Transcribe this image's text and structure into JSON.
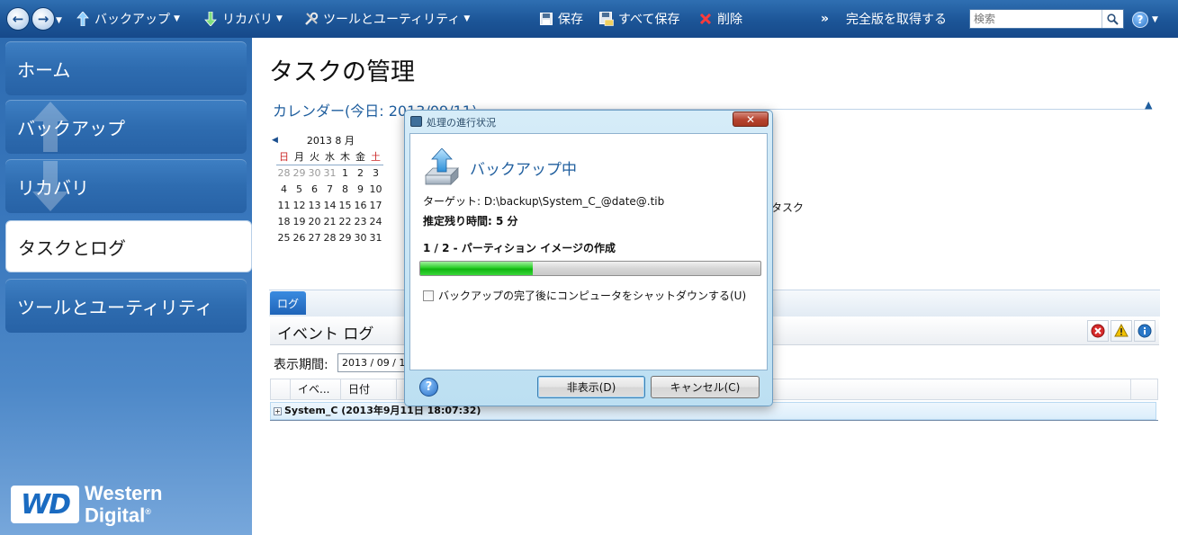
{
  "toolbar": {
    "backup_label": "バックアップ",
    "recovery_label": "リカバリ",
    "tools_label": "ツールとユーティリティ",
    "save_label": "保存",
    "save_all_label": "すべて保存",
    "delete_label": "削除",
    "more_label": "»",
    "full_version_label": "完全版を取得する",
    "search_placeholder": "検索"
  },
  "sidebar": {
    "items": [
      {
        "label": "ホーム"
      },
      {
        "label": "バックアップ"
      },
      {
        "label": "リカバリ"
      },
      {
        "label": "タスクとログ"
      },
      {
        "label": "ツールとユーティリティ"
      }
    ],
    "logo_badge": "WD",
    "logo_line1": "Western",
    "logo_line2": "Digital"
  },
  "main": {
    "title": "タスクの管理",
    "calendar_header": "カレンダー(今日: 2013/09/11)",
    "calendar_month": "2013 8 月",
    "weekdays": [
      "日",
      "月",
      "火",
      "水",
      "木",
      "金",
      "土"
    ],
    "weeks": [
      [
        "28",
        "29",
        "30",
        "31",
        "1",
        "2",
        "3"
      ],
      [
        "4",
        "5",
        "6",
        "7",
        "8",
        "9",
        "10"
      ],
      [
        "11",
        "12",
        "13",
        "14",
        "15",
        "16",
        "17"
      ],
      [
        "18",
        "19",
        "20",
        "21",
        "22",
        "23",
        "24"
      ],
      [
        "25",
        "26",
        "27",
        "28",
        "29",
        "30",
        "31"
      ]
    ],
    "task_text": "たタスク",
    "log_tab": "ログ",
    "event_log_title": "イベント ログ",
    "period_label": "表示期間:",
    "period_value": "2013 / 09 / 11",
    "columns": [
      "イベ...",
      "日付"
    ],
    "row_text": "System_C  (2013年9月11日 18:07:32)"
  },
  "dialog": {
    "title": "処理の進行状況",
    "heading": "バックアップ中",
    "target": "ターゲット: D:\\backup\\System_C_@date@.tib",
    "remaining": "推定残り時間: 5 分",
    "step": "1 / 2 - パーティション イメージの作成",
    "progress": 0.33,
    "shutdown_label": "バックアップの完了後にコンピュータをシャットダウンする(U)",
    "hide_button": "非表示(D)",
    "cancel_button": "キャンセル(C)",
    "close_glyph": "✕"
  },
  "colors": {
    "accent": "#1f5e9e",
    "toolbar": "#1c5597",
    "progress_green": "#10b510",
    "error_red": "#d62b2b",
    "warning_yellow": "#f2c200",
    "info_blue": "#2a78c8"
  },
  "icons": {
    "back": "back-arrow-icon",
    "forward": "forward-arrow-icon",
    "backup": "backup-arrow-up-icon",
    "recovery": "recovery-arrow-down-icon",
    "tools": "tools-icon",
    "save": "save-disk-icon",
    "save_all": "save-all-icon",
    "delete": "delete-x-icon",
    "search": "search-icon",
    "help": "help-icon"
  }
}
